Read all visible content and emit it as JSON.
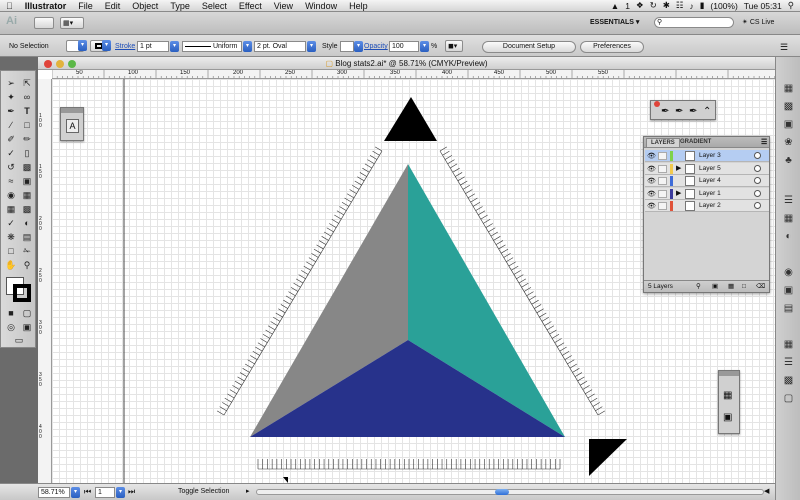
{
  "menubar": {
    "app": "Illustrator",
    "items": [
      "File",
      "Edit",
      "Object",
      "Type",
      "Select",
      "Effect",
      "View",
      "Window",
      "Help"
    ],
    "status": {
      "adobe": "1",
      "battery": "(100%)",
      "clock": "Tue 05:31"
    }
  },
  "appbar": {
    "logo": "Ai",
    "workspace": "ESSENTIALS ▾",
    "cslive": "CS Live"
  },
  "control": {
    "selection": "No Selection",
    "stroke_label": "Stroke",
    "stroke_weight": "1 pt",
    "profile": "Uniform",
    "brush": "2 pt. Oval",
    "style_label": "Style",
    "opacity_label": "Opacity",
    "opacity_value": "100",
    "percent": "%",
    "document_setup": "Document Setup",
    "preferences": "Preferences"
  },
  "document": {
    "title": "Blog stats2.ai* @ 58.71% (CMYK/Preview)",
    "ruler_h": [
      "50",
      "100",
      "150",
      "200",
      "250",
      "300",
      "350",
      "400",
      "450",
      "500",
      "550"
    ],
    "ruler_v": [
      "1 0 0",
      "1 5 0",
      "2 0 0",
      "2 5 0",
      "3 0 0",
      "3 5 0",
      "4 0 0"
    ]
  },
  "artwork": {
    "colors": {
      "gray": "#878787",
      "teal": "#2aa198",
      "navy": "#27328b",
      "black": "#000000"
    }
  },
  "layers_panel": {
    "tabs": [
      "LAYERS",
      "GRADIENT"
    ],
    "rows": [
      {
        "name": "Layer 3",
        "color": "#7fd24a",
        "selected": true,
        "expand": false
      },
      {
        "name": "Layer 5",
        "color": "#f2c94c",
        "selected": false,
        "expand": true
      },
      {
        "name": "Layer 4",
        "color": "#3d6bd8",
        "selected": false,
        "expand": false
      },
      {
        "name": "Layer 1",
        "color": "#3a3a9c",
        "selected": false,
        "expand": true
      },
      {
        "name": "Layer 2",
        "color": "#e0533a",
        "selected": false,
        "expand": false
      }
    ],
    "footer": "5 Layers"
  },
  "status": {
    "zoom": "58.71%",
    "page": "1",
    "toggle": "Toggle Selection"
  },
  "icons": [
    "apple-icon",
    "search-icon",
    "wifi-icon",
    "tool-icons",
    "eye-icon"
  ]
}
